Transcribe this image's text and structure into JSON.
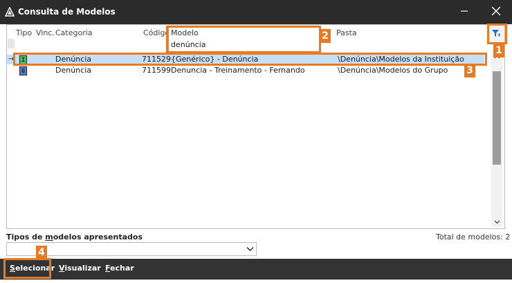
{
  "window": {
    "title": "Consulta de Modelos",
    "icons": {
      "app": "app-logo-icon",
      "minimize": "minimize-icon",
      "close": "close-icon"
    }
  },
  "grid": {
    "columns": [
      "Tipo",
      "Vinc.",
      "Categoria",
      "Código",
      "Modelo",
      "Pasta"
    ],
    "rows": [
      {
        "marker": "→",
        "tipo": "I",
        "categoria": "Denúncia",
        "codigo": "711529",
        "modelo": "{Genérico} - Denúncia",
        "pasta": "\\Denúncia\\Modelos da Instituição",
        "selected": true
      },
      {
        "marker": "",
        "tipo": "G",
        "categoria": "Denúncia",
        "codigo": "711599",
        "modelo": "Denuncia - Treinamento - Fernando",
        "pasta": "\\Denúncia\\Modelos do Grupo",
        "selected": false
      }
    ]
  },
  "search": {
    "label": "Modelo",
    "value": "denúncia"
  },
  "filter": {
    "icon": "filter-icon"
  },
  "footer": {
    "types_label_pre": "Tipos de ",
    "types_label_mnemonic": "m",
    "types_label_post": "odelos apresentados",
    "types_value": "",
    "total_label": "Total de modelos: 2"
  },
  "actions": {
    "select_mnemonic": "S",
    "select_rest": "elecionar",
    "view_mnemonic": "V",
    "view_rest": "isualizar",
    "close_mnemonic": "F",
    "close_rest": "echar"
  },
  "callouts": [
    "1",
    "2",
    "3",
    "4"
  ],
  "colors": {
    "titlebar": "#2b2b2b",
    "bottombar": "#333333",
    "selection": "#c6def6",
    "callout": "#e87a22",
    "badge_i": "#3dbf5a",
    "badge_g": "#4a7fd6",
    "filter_accent": "#1e6fd9"
  }
}
